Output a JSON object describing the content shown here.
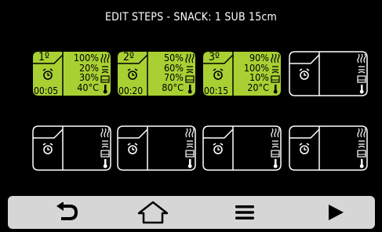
{
  "header": {
    "title": "EDIT STEPS - SNACK: 1 SUB 15cm"
  },
  "colors": {
    "active": "#a8d033",
    "background": "#000000",
    "toolbar": "#d6d6d6"
  },
  "steps": [
    {
      "number": "1º",
      "time": "00:05",
      "values": [
        "100%",
        "20%",
        "30%",
        "40°C"
      ]
    },
    {
      "number": "2º",
      "time": "00:20",
      "values": [
        "50%",
        "60%",
        "70%",
        "80°C"
      ]
    },
    {
      "number": "3º",
      "time": "00:15",
      "values": [
        "90%",
        "100%",
        "10%",
        "20°C"
      ]
    }
  ],
  "icons": {
    "heat": "heat-icon",
    "microwave": "microwave-icon",
    "timer": "alarm-clock-icon",
    "thermometer": "thermometer-icon"
  },
  "toolbar": {
    "buttons": [
      "back-icon",
      "home-icon",
      "menu-icon",
      "play-icon"
    ]
  }
}
